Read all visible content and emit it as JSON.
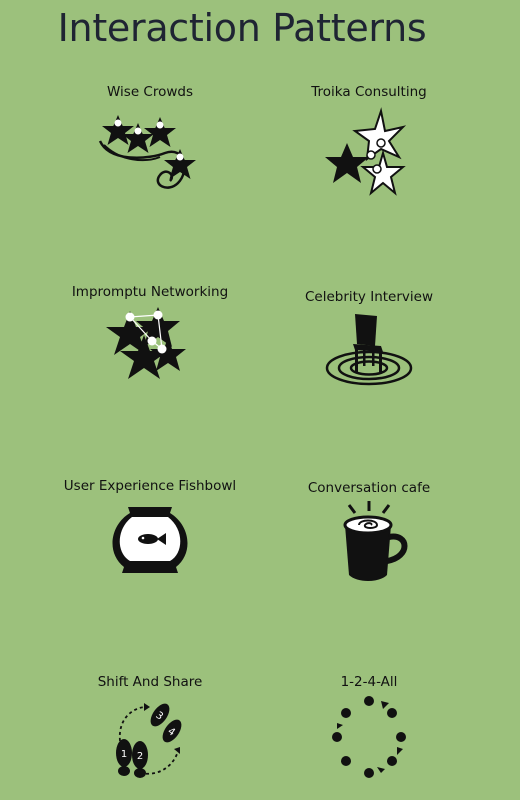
{
  "title": "Interaction Patterns",
  "patterns": [
    {
      "label": "Wise Crowds",
      "icon": "wise-crowds-icon"
    },
    {
      "label": "Troika Consulting",
      "icon": "troika-consulting-icon"
    },
    {
      "label": "Impromptu Networking",
      "icon": "impromptu-networking-icon"
    },
    {
      "label": "Celebrity Interview",
      "icon": "celebrity-interview-icon"
    },
    {
      "label": "User Experience Fishbowl",
      "icon": "fishbowl-icon"
    },
    {
      "label": "Conversation cafe",
      "icon": "coffee-cup-icon"
    },
    {
      "label": "Shift And Share",
      "icon": "footprints-icon"
    },
    {
      "label": "1-2-4-All",
      "icon": "dots-circle-icon"
    }
  ],
  "footprint_numbers": [
    "1",
    "2",
    "3",
    "4"
  ],
  "colors": {
    "background": "#9cc17c",
    "title": "#1f2433",
    "icon": "#111111",
    "icon_light": "#ffffff"
  }
}
